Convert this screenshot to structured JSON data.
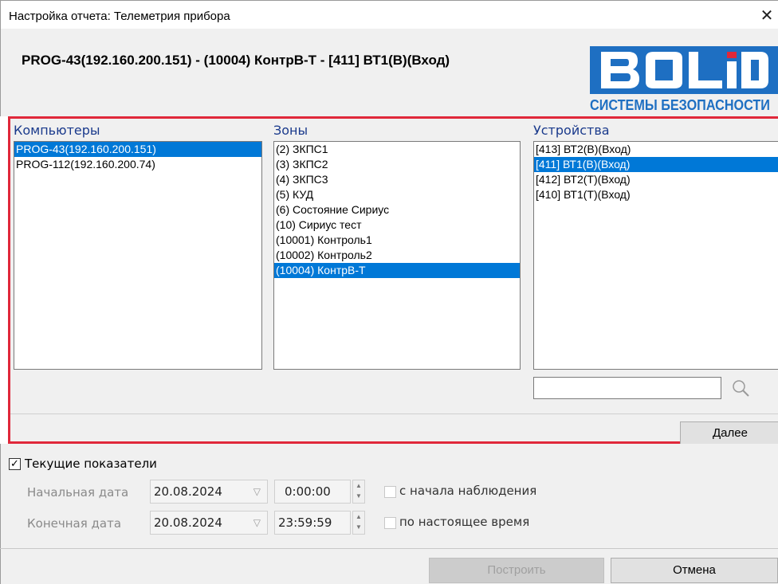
{
  "window": {
    "title": "Настройка отчета: Телеметрия прибора",
    "close_glyph": "✕"
  },
  "header": {
    "path": "PROG-43(192.160.200.151) - (10004) КонтрВ-Т - [411] ВТ1(В)(Вход)",
    "logo_tagline": "СИСТЕМЫ БЕЗОПАСНОСТИ",
    "logo_brand": "BOLID",
    "logo_color": "#1e6fc2"
  },
  "selection": {
    "computers": {
      "label": "Компьютеры",
      "items": [
        "PROG-43(192.160.200.151)",
        "PROG-112(192.160.200.74)"
      ],
      "selected_index": 0
    },
    "zones": {
      "label": "Зоны",
      "items": [
        "(2) ЗКПС1",
        "(3) ЗКПС2",
        "(4) ЗКПС3",
        "(5) КУД",
        "(6) Состояние Сириус",
        "(10) Сириус тест",
        "(10001) Контроль1",
        "(10002) Контроль2",
        "(10004) КонтрВ-Т"
      ],
      "selected_index": 8
    },
    "devices": {
      "label": "Устройства",
      "items": [
        "[413] ВТ2(В)(Вход)",
        "[411] ВТ1(В)(Вход)",
        "[412] ВТ2(Т)(Вход)",
        "[410] ВТ1(Т)(Вход)"
      ],
      "selected_index": 1
    },
    "search_value": "",
    "search_icon": "magnifier-icon",
    "next_label": "Далее"
  },
  "options": {
    "current_values": {
      "label": "Текущие показатели",
      "checked": true
    },
    "start": {
      "label": "Начальная дата",
      "date": "20.08.2024",
      "time": "0:00:00",
      "from_start_label": "с начала наблюдения",
      "from_start_checked": false
    },
    "end": {
      "label": "Конечная дата",
      "date": "20.08.2024",
      "time": "23:59:59",
      "until_now_label": "по настоящее время",
      "until_now_checked": false
    }
  },
  "footer": {
    "build_label": "Построить",
    "cancel_label": "Отмена"
  },
  "colors": {
    "selection": "#0078d7",
    "frame": "#e0283a",
    "column_label": "#1a3a8c"
  }
}
